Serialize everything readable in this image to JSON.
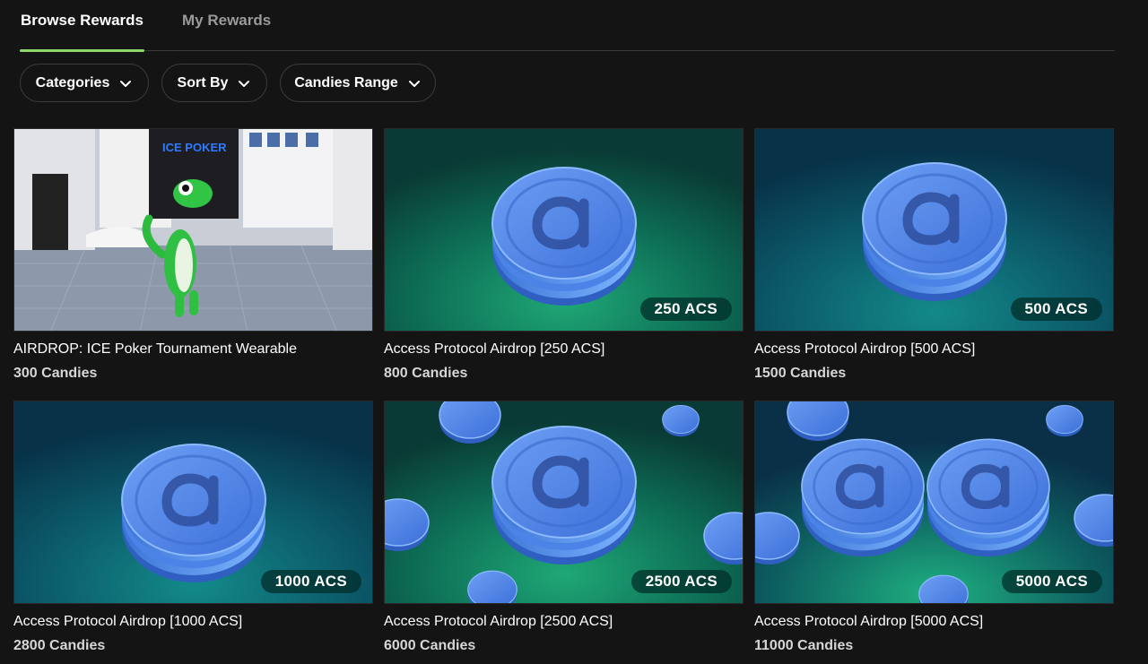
{
  "tabs": [
    {
      "label": "Browse Rewards",
      "active": true
    },
    {
      "label": "My Rewards",
      "active": false
    }
  ],
  "filters": {
    "categories": "Categories",
    "sort_by": "Sort By",
    "candies_range": "Candies Range"
  },
  "colors": {
    "accent": "#8fd86e",
    "background": "#141414"
  },
  "rewards": [
    {
      "title": "AIRDROP: ICE Poker Tournament Wearable",
      "price": "300 Candies",
      "badge": "",
      "image": "ice-poker-gecko-scene",
      "image_text": "ICE POKER"
    },
    {
      "title": "Access Protocol Airdrop [250 ACS]",
      "price": "800 Candies",
      "badge": "250 ACS",
      "image": "acs-coin-stack"
    },
    {
      "title": "Access Protocol Airdrop [500 ACS]",
      "price": "1500 Candies",
      "badge": "500 ACS",
      "image": "acs-coin-stack"
    },
    {
      "title": "Access Protocol Airdrop [1000 ACS]",
      "price": "2800 Candies",
      "badge": "1000 ACS",
      "image": "acs-coin-stack"
    },
    {
      "title": "Access Protocol Airdrop [2500 ACS]",
      "price": "6000 Candies",
      "badge": "2500 ACS",
      "image": "acs-coin-stack"
    },
    {
      "title": "Access Protocol Airdrop [5000 ACS]",
      "price": "11000 Candies",
      "badge": "5000 ACS",
      "image": "acs-coin-stacks"
    }
  ]
}
